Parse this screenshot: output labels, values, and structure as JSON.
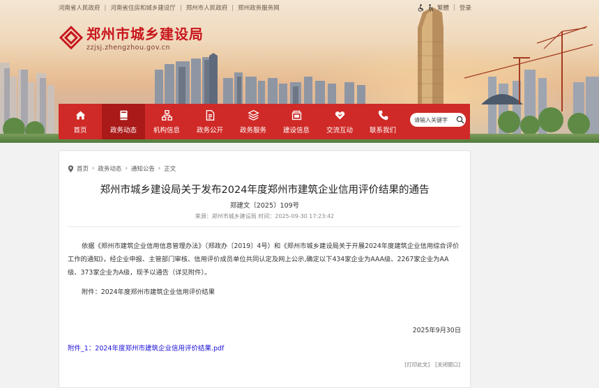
{
  "top_links": [
    "河南省人民政府",
    "河南省住房和城乡建设厅",
    "郑州市人民政府",
    "郑州政务服务网"
  ],
  "tools": {
    "accessibility_icon": "accessibility-icon",
    "traditional": "繁體",
    "login": "登录"
  },
  "site": {
    "title": "郑州市城乡建设局",
    "url": "zzjsj.zhengzhou.gov.cn"
  },
  "nav": [
    {
      "label": "首页",
      "icon": "home-icon"
    },
    {
      "label": "政务动态",
      "icon": "book-icon",
      "active": true
    },
    {
      "label": "机构信息",
      "icon": "org-chart-icon"
    },
    {
      "label": "政务公开",
      "icon": "document-icon"
    },
    {
      "label": "政务服务",
      "icon": "layers-icon"
    },
    {
      "label": "建设信息",
      "icon": "folder-icon"
    },
    {
      "label": "交流互动",
      "icon": "handshake-icon"
    },
    {
      "label": "联系我们",
      "icon": "phone-icon"
    }
  ],
  "search": {
    "placeholder": "请输入关键字"
  },
  "breadcrumb": [
    "首页",
    "政务动态",
    "通知公告",
    "正文"
  ],
  "article": {
    "title": "郑州市城乡建设局关于发布2024年度郑州市建筑企业信用评价结果的通告",
    "doc_number": "郑建文〔2025〕109号",
    "meta": "来源：郑州市城乡建设局  时间：2025-09-30 17:23:42",
    "paragraph": "依据《郑州市建筑企业信用信息管理办法》（郑政办〔2019〕4号）和《郑州市城乡建设局关于开展2024年度建筑企业信用综合评价工作的通知》，经企业申报、主管部门审核、信用评价成员单位共同认定及网上公示,确定以下434家企业为AAA级、2267家企业为AA级、373家企业为A级，现予以通告（详见附件）。",
    "attachment_note": "附件：2024年度郑州市建筑企业信用评价结果",
    "date": "2025年9月30日",
    "attachment_link": "附件_1：2024年度郑州市建筑企业信用评价结果.pdf",
    "print": "[打印此文]",
    "close": "[关闭窗口]"
  },
  "colors": {
    "brand_red": "#cf2a27",
    "nav_active": "#a91a18",
    "link_blue": "#1a0fd8"
  }
}
